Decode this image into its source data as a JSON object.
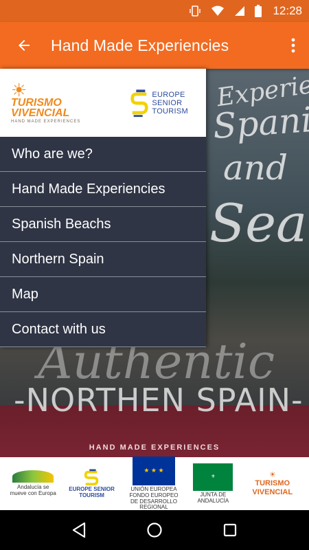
{
  "status_bar": {
    "time": "12:28",
    "icons": [
      "vibrate-icon",
      "wifi-icon",
      "signal-icon",
      "battery-icon"
    ]
  },
  "app_bar": {
    "title": "Hand Made Experiencies",
    "back_icon": "arrow-back-icon",
    "menu_icon": "more-vertical-icon"
  },
  "drawer": {
    "logo_left": {
      "name": "TURISMO VIVENCIAL",
      "tagline": "HAND MADE EXPERIENCES"
    },
    "logo_right": {
      "lines": [
        "EUROPE",
        "SENIOR",
        "TOURISM"
      ]
    },
    "items": [
      {
        "label": "Who are we?"
      },
      {
        "label": "Hand Made Experiencies"
      },
      {
        "label": "Spanish Beachs"
      },
      {
        "label": "Northern Spain"
      },
      {
        "label": "Map"
      },
      {
        "label": "Contact with us"
      }
    ]
  },
  "poster": {
    "line1": "Experience",
    "line2": "Spanish",
    "line3": "and",
    "line4": "Sea",
    "line5": "Authentic",
    "line6": "-NORTHEN SPAIN-",
    "band_text": "HAND MADE EXPERIENCES"
  },
  "footer": {
    "andalucia": "Andalucía se mueve con Europa",
    "est": "EUROPE SENIOR TOURISM",
    "eu": "UNIÓN EUROPEA FONDO EUROPEO DE DESARROLLO REGIONAL",
    "junta": "JUNTA DE ANDALUCÍA",
    "tv": "TURISMO VIVENCIAL"
  },
  "colors": {
    "accent": "#f26b21",
    "status": "#e0661f",
    "drawer_item": "#2f3545",
    "band": "#7a2433"
  }
}
